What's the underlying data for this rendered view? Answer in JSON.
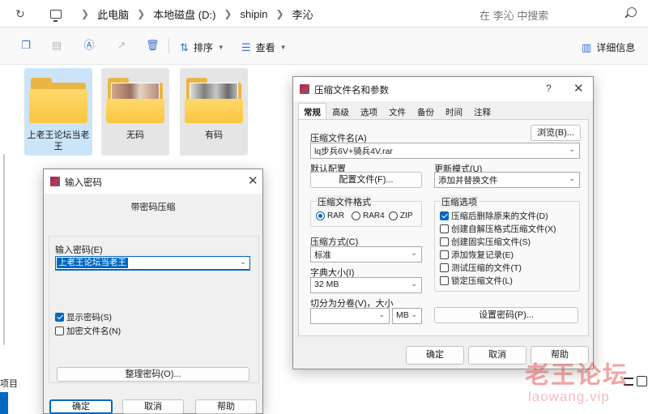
{
  "addressbar": {
    "crumbs": [
      "此电脑",
      "本地磁盘 (D:)",
      "shipin",
      "李沁"
    ],
    "search_placeholder": "在 李沁 中搜索"
  },
  "toolbar": {
    "sort_label": "排序",
    "view_label": "查看",
    "details_label": "详细信息"
  },
  "folders": [
    {
      "name": "上老王论坛当老王",
      "state": "selected",
      "thumbnail": false
    },
    {
      "name": "无码",
      "state": "hover",
      "thumbnail": true
    },
    {
      "name": "有码",
      "state": "hover",
      "thumbnail": true
    }
  ],
  "statusbar": {
    "left_text": "项目"
  },
  "password_dialog": {
    "title": "输入密码",
    "heading": "带密码压缩",
    "password_label": "输入密码(E)",
    "password_value": "上老王论坛当老王",
    "show_password": {
      "label": "显示密码(S)",
      "checked": true
    },
    "encrypt_names": {
      "label": "加密文件名(N)",
      "checked": false
    },
    "organize_button": "整理密码(O)...",
    "ok_button": "确定",
    "cancel_button": "取消",
    "help_button": "帮助"
  },
  "archive_dialog": {
    "title": "压缩文件名和参数",
    "help_glyph": "?",
    "tabs": [
      "常规",
      "高级",
      "选项",
      "文件",
      "备份",
      "时间",
      "注释"
    ],
    "active_tab": "常规",
    "archive_name_label": "压缩文件名(A)",
    "browse_button": "浏览(B)...",
    "archive_name_value": "lq步兵6V+骑兵4V.rar",
    "default_profile_label": "默认配置",
    "profile_button": "配置文件(F)...",
    "update_mode_label": "更新模式(U)",
    "update_mode_value": "添加并替换文件",
    "format_group": "压缩文件格式",
    "formats": [
      {
        "label": "RAR",
        "selected": true
      },
      {
        "label": "RAR4",
        "selected": false
      },
      {
        "label": "ZIP",
        "selected": false
      }
    ],
    "method_label": "压缩方式(C)",
    "method_value": "标准",
    "dict_label": "字典大小(I)",
    "dict_value": "32 MB",
    "split_label": "切分为分卷(V)，大小",
    "split_value": "",
    "split_unit": "MB",
    "options_group": "压缩选项",
    "options": [
      {
        "label": "压缩后删除原来的文件(D)",
        "checked": true
      },
      {
        "label": "创建自解压格式压缩文件(X)",
        "checked": false
      },
      {
        "label": "创建固实压缩文件(S)",
        "checked": false
      },
      {
        "label": "添加恢复记录(E)",
        "checked": false
      },
      {
        "label": "测试压缩的文件(T)",
        "checked": false
      },
      {
        "label": "锁定压缩文件(L)",
        "checked": false
      }
    ],
    "set_password_button": "设置密码(P)...",
    "ok_button": "确定",
    "cancel_button": "取消",
    "help_button": "帮助"
  },
  "watermark": {
    "text": "老王论坛",
    "url": "laowang.vip"
  },
  "colors": {
    "accent": "#0067c0",
    "folder": "#f8c741",
    "selected": "#cce4f7",
    "watermark": "#e23c3c"
  }
}
